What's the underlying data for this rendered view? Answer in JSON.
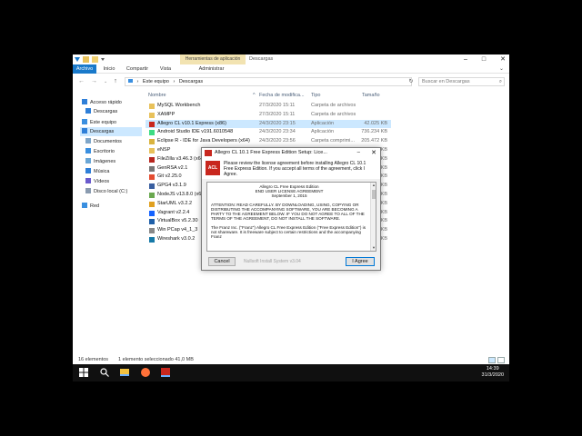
{
  "window": {
    "contextual_tab": "Herramientas de aplicación",
    "title": "Descargas",
    "minimize": "–",
    "maximize": "□",
    "close": "✕"
  },
  "ribbon": {
    "tabs": [
      "Archivo",
      "Inicio",
      "Compartir",
      "Vista",
      "Administrar"
    ],
    "expand": "⌄"
  },
  "address": {
    "back": "←",
    "forward": "→",
    "recent": "⌄",
    "up": "↑",
    "path": [
      "Este equipo",
      "Descargas"
    ],
    "search_placeholder": "Buscar en Descargas",
    "refresh": "↻",
    "search_icon": "⌕"
  },
  "sidebar": {
    "items": [
      {
        "label": "Acceso rápido",
        "icon": "star-icon",
        "color": "#2f7fd8"
      },
      {
        "label": "Descargas",
        "icon": "download-folder-icon",
        "color": "#2f7fd8"
      },
      {
        "label": "Este equipo",
        "icon": "computer-icon",
        "color": "#3a8fe0"
      },
      {
        "label": "Descargas",
        "icon": "download-folder-icon",
        "color": "#2f7fd8"
      },
      {
        "label": "Documentos",
        "icon": "documents-icon",
        "color": "#7fa6c9"
      },
      {
        "label": "Escritorio",
        "icon": "desktop-icon",
        "color": "#3a8fe0"
      },
      {
        "label": "Imágenes",
        "icon": "pictures-icon",
        "color": "#6aa6d6"
      },
      {
        "label": "Música",
        "icon": "music-icon",
        "color": "#2f7fd8"
      },
      {
        "label": "Vídeos",
        "icon": "videos-icon",
        "color": "#6a5acd"
      },
      {
        "label": "Disco local (C:)",
        "icon": "drive-icon",
        "color": "#8a9bb0"
      },
      {
        "label": "Red",
        "icon": "network-icon",
        "color": "#3a8fe0"
      }
    ]
  },
  "columns": {
    "name": "Nombre",
    "date": "Fecha de modifica...",
    "type": "Tipo",
    "size": "Tamaño",
    "sort": "^"
  },
  "files": [
    {
      "name": "MySQL Workbench",
      "date": "27/3/2020 15:11",
      "type": "Carpeta de archivos",
      "size": "",
      "icon": "folder-icon",
      "color": "#e8c15a"
    },
    {
      "name": "XAMPP",
      "date": "27/3/2020 15:11",
      "type": "Carpeta de archivos",
      "size": "",
      "icon": "folder-icon",
      "color": "#e8c15a"
    },
    {
      "name": "Allegro CL v10.1 Express (x86)",
      "date": "24/3/2020 23:15",
      "type": "Aplicación",
      "size": "42.025 KB",
      "icon": "allegro-app-icon",
      "color": "#c8271e"
    },
    {
      "name": "Android Studio IDE v191.6010548",
      "date": "24/3/2020 23:34",
      "type": "Aplicación",
      "size": "736.234 KB",
      "icon": "android-studio-icon",
      "color": "#3ddc84"
    },
    {
      "name": "Eclipse R - IDE for Java Developers (x64)",
      "date": "24/3/2020 23:56",
      "type": "Carpeta comprimi...",
      "size": "205.472 KB",
      "icon": "zip-folder-icon",
      "color": "#d9b33f"
    },
    {
      "name": "eNSP",
      "date": "",
      "type": "",
      "size": "KB",
      "icon": "folder-icon",
      "color": "#e8c15a"
    },
    {
      "name": "FileZilla v3.46.3 (x64)",
      "date": "",
      "type": "",
      "size": "KB",
      "icon": "filezilla-icon",
      "color": "#b8261e"
    },
    {
      "name": "GenRSA v2.1",
      "date": "",
      "type": "",
      "size": "KB",
      "icon": "app-icon",
      "color": "#777777"
    },
    {
      "name": "Git v2.25.0",
      "date": "",
      "type": "",
      "size": "KB",
      "icon": "git-icon",
      "color": "#e44c30"
    },
    {
      "name": "GPG4 v3.1.9",
      "date": "",
      "type": "",
      "size": "KB",
      "icon": "gpg-icon",
      "color": "#3a5fa0"
    },
    {
      "name": "NodeJS v13.8.0 (x64)",
      "date": "",
      "type": "",
      "size": "KB",
      "icon": "nodejs-icon",
      "color": "#6aa84f"
    },
    {
      "name": "StarUML v3.2.2",
      "date": "",
      "type": "",
      "size": "KB",
      "icon": "staruml-icon",
      "color": "#e0a020"
    },
    {
      "name": "Vagrant v2.2.4",
      "date": "",
      "type": "",
      "size": "KB",
      "icon": "vagrant-icon",
      "color": "#1563ff"
    },
    {
      "name": "VirtualBox v5.2.30",
      "date": "",
      "type": "",
      "size": "KB",
      "icon": "virtualbox-icon",
      "color": "#1f5fa8"
    },
    {
      "name": "Win PCap v4_1_3",
      "date": "",
      "type": "",
      "size": "KB",
      "icon": "winpcap-icon",
      "color": "#888888"
    },
    {
      "name": "Wireshark v3.0.2",
      "date": "",
      "type": "",
      "size": "KB",
      "icon": "wireshark-icon",
      "color": "#1679a7"
    }
  ],
  "selected_index": 2,
  "status": {
    "count": "16 elementos",
    "selection": "1 elemento seleccionado 41,0 MB"
  },
  "dialog": {
    "title": "Allegro CL 10.1 Free Express Edition Setup: Lice...",
    "minimize": "–",
    "close": "✕",
    "logo_text": "ACL",
    "intro": "Please review the license agreement before installing Allegro CL 10.1 Free Express Edition. If you accept all terms of the agreement, click I Agree.",
    "license_title_1": "Allegro CL Free Express Edition",
    "license_title_2": "END USER LICENSE AGREEMENT",
    "license_date": "September 1, 2015",
    "license_p1": "ATTENTION: READ CAREFULLY. BY DOWNLOADING, USING, COPYING OR DISTRIBUTING THE ACCOMPANYING SOFTWARE, YOU ARE BECOMING A PARTY TO THE AGREEMENT BELOW. IF YOU DO NOT AGREE TO ALL OF THE TERMS OF THE AGREEMENT, DO NOT INSTALL THE SOFTWARE.",
    "license_p2": "The Franz Inc. (\"Franz\") Allegro CL Free Express Edition (\"Free Express Edition\") is not shareware. It is freeware subject to certain restrictions and the accompanying Franz",
    "scroll_up": "▲",
    "scroll_down": "▼",
    "cancel": "Cancel",
    "nsis": "Nullsoft Install System v3.04",
    "agree": "I Agree"
  },
  "taskbar": {
    "time": "14:39",
    "date": "31/3/2020",
    "icons": [
      {
        "name": "start-icon",
        "color": "#ffffff"
      },
      {
        "name": "search-icon",
        "color": "#ffffff"
      },
      {
        "name": "file-explorer-icon",
        "color": "#f0c040"
      },
      {
        "name": "firefox-icon",
        "color": "#ff7139"
      },
      {
        "name": "allegro-taskbar-icon",
        "color": "#c8271e"
      }
    ]
  }
}
